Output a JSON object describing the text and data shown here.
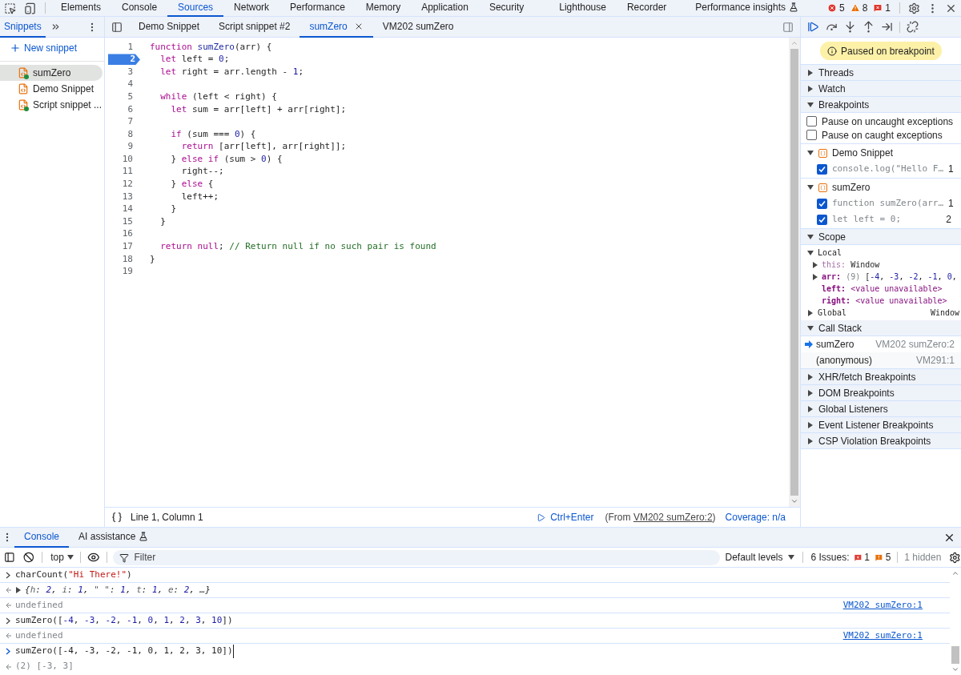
{
  "top_tabs": [
    {
      "label": "Elements",
      "selected": false
    },
    {
      "label": "Console",
      "selected": false
    },
    {
      "label": "Sources",
      "selected": true
    },
    {
      "label": "Network",
      "selected": false
    },
    {
      "label": "Performance",
      "selected": false
    },
    {
      "label": "Memory",
      "selected": false
    },
    {
      "label": "Application",
      "selected": false
    },
    {
      "label": "Security",
      "selected": false
    },
    {
      "label": "Lighthouse",
      "selected": false
    },
    {
      "label": "Recorder",
      "selected": false
    },
    {
      "label": "Performance insights",
      "selected": false,
      "experimental": true
    }
  ],
  "counters": {
    "errors": "5",
    "warnings": "8",
    "issues": "1"
  },
  "navigator": {
    "tab": {
      "label": "Snippets",
      "selected": true
    },
    "new_snippet": "New snippet",
    "files": [
      {
        "name": "sumZero",
        "selected": true,
        "running": true
      },
      {
        "name": "Demo Snippet",
        "selected": false,
        "running": false
      },
      {
        "name": "Script snippet ...",
        "selected": false,
        "running": true
      }
    ]
  },
  "editor_tabs": [
    {
      "label": "Demo Snippet",
      "selected": false
    },
    {
      "label": "Script snippet #2",
      "selected": false
    },
    {
      "label": "sumZero",
      "selected": true
    },
    {
      "label": "VM202 sumZero",
      "selected": false
    }
  ],
  "code_lines": [
    {
      "number": "1",
      "paused": false,
      "tokens": [
        {
          "text": "function ",
          "kind": "keyword"
        },
        {
          "text": "sumZero",
          "kind": "name"
        },
        {
          "text": "(arr) {",
          "kind": "plain"
        }
      ]
    },
    {
      "number": "2",
      "paused": true,
      "tokens": [
        {
          "text": "  let",
          "kind": "keyword"
        },
        {
          "text": " left = ",
          "kind": "plain"
        },
        {
          "text": "0",
          "kind": "number"
        },
        {
          "text": ";",
          "kind": "plain"
        }
      ]
    },
    {
      "number": "3",
      "paused": false,
      "tokens": [
        {
          "text": "  let",
          "kind": "keyword"
        },
        {
          "text": " right = arr.length - ",
          "kind": "plain"
        },
        {
          "text": "1",
          "kind": "number"
        },
        {
          "text": ";",
          "kind": "plain"
        }
      ]
    },
    {
      "number": "4",
      "paused": false
    },
    {
      "number": "5",
      "paused": false,
      "tokens": [
        {
          "text": "  while",
          "kind": "keyword"
        },
        {
          "text": " (left < right) {",
          "kind": "plain"
        }
      ]
    },
    {
      "number": "6",
      "paused": false,
      "tokens": [
        {
          "text": "    let",
          "kind": "keyword"
        },
        {
          "text": " sum = arr[left] + arr[right];",
          "kind": "plain"
        }
      ]
    },
    {
      "number": "7",
      "paused": false
    },
    {
      "number": "8",
      "paused": false,
      "tokens": [
        {
          "text": "    if",
          "kind": "keyword"
        },
        {
          "text": " (sum === ",
          "kind": "plain"
        },
        {
          "text": "0",
          "kind": "number"
        },
        {
          "text": ") {",
          "kind": "plain"
        }
      ]
    },
    {
      "number": "9",
      "paused": false,
      "tokens": [
        {
          "text": "      return",
          "kind": "keyword"
        },
        {
          "text": " [arr[left], arr[right]];",
          "kind": "plain"
        }
      ]
    },
    {
      "number": "10",
      "paused": false,
      "tokens": [
        {
          "text": "    } ",
          "kind": "plain"
        },
        {
          "text": "else if",
          "kind": "keyword"
        },
        {
          "text": " (sum > ",
          "kind": "plain"
        },
        {
          "text": "0",
          "kind": "number"
        },
        {
          "text": ") {",
          "kind": "plain"
        }
      ]
    },
    {
      "number": "11",
      "paused": false,
      "tokens": [
        {
          "text": "      right--;",
          "kind": "plain"
        }
      ]
    },
    {
      "number": "12",
      "paused": false,
      "tokens": [
        {
          "text": "    } ",
          "kind": "plain"
        },
        {
          "text": "else",
          "kind": "keyword"
        },
        {
          "text": " {",
          "kind": "plain"
        }
      ]
    },
    {
      "number": "13",
      "paused": false,
      "tokens": [
        {
          "text": "      left++;",
          "kind": "plain"
        }
      ]
    },
    {
      "number": "14",
      "paused": false,
      "tokens": [
        {
          "text": "    }",
          "kind": "plain"
        }
      ]
    },
    {
      "number": "15",
      "paused": false,
      "tokens": [
        {
          "text": "  }",
          "kind": "plain"
        }
      ]
    },
    {
      "number": "16",
      "paused": false
    },
    {
      "number": "17",
      "paused": false,
      "tokens": [
        {
          "text": "  return null",
          "kind": "keyword"
        },
        {
          "text": "; ",
          "kind": "plain"
        },
        {
          "text": "// Return null if no such pair is found",
          "kind": "comment"
        }
      ]
    },
    {
      "number": "18",
      "paused": false,
      "tokens": [
        {
          "text": "}",
          "kind": "plain"
        }
      ]
    },
    {
      "number": "19",
      "paused": false
    }
  ],
  "status_bar": {
    "position": "Line 1, Column 1",
    "run": "Ctrl+Enter",
    "from_prefix": "(From",
    "from_link": "VM202 sumZero:2",
    "from_suffix": ")",
    "coverage": "Coverage: n/a"
  },
  "debugger": {
    "paused_message": "Paused on breakpoint",
    "sections": [
      {
        "kind": "plain",
        "title": "Threads",
        "expanded": false
      },
      {
        "kind": "plain",
        "title": "Watch",
        "expanded": false
      },
      {
        "kind": "breakpoints",
        "title": "Breakpoints",
        "expanded": true,
        "options": [
          {
            "label": "Pause on uncaught exceptions",
            "checked": false
          },
          {
            "label": "Pause on caught exceptions",
            "checked": false
          }
        ],
        "groups": [
          {
            "file": "Demo Snippet",
            "expanded": true,
            "items": [
              {
                "code": "console.log(\"Hello F…",
                "line": "1",
                "checked": true
              }
            ]
          },
          {
            "file": "sumZero",
            "expanded": true,
            "items": [
              {
                "code": "function sumZero(arr…",
                "line": "1",
                "checked": true
              },
              {
                "code": "let left = 0;",
                "line": "2",
                "checked": true
              }
            ]
          }
        ]
      },
      {
        "kind": "scope",
        "title": "Scope",
        "expanded": true,
        "scopes": [
          {
            "name": "Local",
            "expanded": true,
            "vars": [
              {
                "name": "this:",
                "dim": true,
                "expandable": true,
                "value": [
                  {
                    "text": "Window",
                    "kind": "plain"
                  }
                ]
              },
              {
                "name": "arr:",
                "dim": false,
                "expandable": true,
                "value": [
                  {
                    "text": "(9) ",
                    "kind": "dim"
                  },
                  {
                    "text": "[",
                    "kind": "plain"
                  },
                  {
                    "text": "-4",
                    "kind": "number"
                  },
                  {
                    "text": ", ",
                    "kind": "plain"
                  },
                  {
                    "text": "-3",
                    "kind": "number"
                  },
                  {
                    "text": ", ",
                    "kind": "plain"
                  },
                  {
                    "text": "-2",
                    "kind": "number"
                  },
                  {
                    "text": ", ",
                    "kind": "plain"
                  },
                  {
                    "text": "-1",
                    "kind": "number"
                  },
                  {
                    "text": ", ",
                    "kind": "plain"
                  },
                  {
                    "text": "0",
                    "kind": "number"
                  },
                  {
                    "text": ",",
                    "kind": "plain"
                  }
                ]
              },
              {
                "name": "left:",
                "dim": false,
                "expandable": false,
                "value": [
                  {
                    "text": "<value unavailable>",
                    "kind": "unavailable"
                  }
                ]
              },
              {
                "name": "right:",
                "dim": false,
                "expandable": false,
                "value": [
                  {
                    "text": "<value unavailable>",
                    "kind": "unavailable"
                  }
                ]
              }
            ]
          },
          {
            "name": "Global",
            "expanded": false,
            "value": "Window"
          }
        ]
      },
      {
        "kind": "callstack",
        "title": "Call Stack",
        "expanded": true,
        "frames": [
          {
            "name": "sumZero",
            "location": "VM202 sumZero:2",
            "selected": true
          },
          {
            "name": "(anonymous)",
            "location": "VM291:1",
            "selected": false
          }
        ]
      },
      {
        "kind": "plain",
        "title": "XHR/fetch Breakpoints",
        "expanded": false
      },
      {
        "kind": "plain",
        "title": "DOM Breakpoints",
        "expanded": false
      },
      {
        "kind": "plain",
        "title": "Global Listeners",
        "expanded": false
      },
      {
        "kind": "plain",
        "title": "Event Listener Breakpoints",
        "expanded": false
      },
      {
        "kind": "plain",
        "title": "CSP Violation Breakpoints",
        "expanded": false
      }
    ]
  },
  "drawer_tabs": [
    {
      "label": "Console",
      "selected": true,
      "experimental": false
    },
    {
      "label": "AI assistance",
      "selected": false,
      "experimental": true
    }
  ],
  "console_toolbar": {
    "context": "top",
    "filter_placeholder": "Filter",
    "levels": "Default levels",
    "issues_label": "6 Issues:",
    "issue_errors": "1",
    "issue_warnings": "5",
    "hidden": "1 hidden"
  },
  "console": [
    {
      "kind": "input",
      "active": false,
      "tokens": [
        {
          "text": "charCount(",
          "kind": "plain"
        },
        {
          "text": "\"Hi There!\"",
          "kind": "string"
        },
        {
          "text": ")",
          "kind": "plain"
        }
      ]
    },
    {
      "kind": "object",
      "tokens": [
        {
          "text": "{",
          "kind": "plain"
        },
        {
          "text": "h",
          "kind": "key"
        },
        {
          "text": ": ",
          "kind": "plain"
        },
        {
          "text": "2",
          "kind": "number"
        },
        {
          "text": ", ",
          "kind": "plain"
        },
        {
          "text": "i",
          "kind": "key"
        },
        {
          "text": ": ",
          "kind": "plain"
        },
        {
          "text": "1",
          "kind": "number"
        },
        {
          "text": ", ",
          "kind": "plain"
        },
        {
          "text": "\" \"",
          "kind": "key"
        },
        {
          "text": ": ",
          "kind": "plain"
        },
        {
          "text": "1",
          "kind": "number"
        },
        {
          "text": ", ",
          "kind": "plain"
        },
        {
          "text": "t",
          "kind": "key"
        },
        {
          "text": ": ",
          "kind": "plain"
        },
        {
          "text": "1",
          "kind": "number"
        },
        {
          "text": ", ",
          "kind": "plain"
        },
        {
          "text": "e",
          "kind": "key"
        },
        {
          "text": ": ",
          "kind": "plain"
        },
        {
          "text": "2",
          "kind": "number"
        },
        {
          "text": ", …}",
          "kind": "plain"
        }
      ]
    },
    {
      "kind": "result",
      "tokens": [
        {
          "text": "undefined",
          "kind": "dim"
        }
      ],
      "link": "VM202 sumZero:1"
    },
    {
      "kind": "input",
      "active": false,
      "tokens": [
        {
          "text": "sumZero([",
          "kind": "plain"
        },
        {
          "text": "-4",
          "kind": "number"
        },
        {
          "text": ", ",
          "kind": "plain"
        },
        {
          "text": "-3",
          "kind": "number"
        },
        {
          "text": ", ",
          "kind": "plain"
        },
        {
          "text": "-2",
          "kind": "number"
        },
        {
          "text": ", ",
          "kind": "plain"
        },
        {
          "text": "-1",
          "kind": "number"
        },
        {
          "text": ", ",
          "kind": "plain"
        },
        {
          "text": "0",
          "kind": "number"
        },
        {
          "text": ", ",
          "kind": "plain"
        },
        {
          "text": "1",
          "kind": "number"
        },
        {
          "text": ", ",
          "kind": "plain"
        },
        {
          "text": "2",
          "kind": "number"
        },
        {
          "text": ", ",
          "kind": "plain"
        },
        {
          "text": "3",
          "kind": "number"
        },
        {
          "text": ", ",
          "kind": "plain"
        },
        {
          "text": "10",
          "kind": "number"
        },
        {
          "text": "])",
          "kind": "plain"
        }
      ]
    },
    {
      "kind": "result",
      "tokens": [
        {
          "text": "undefined",
          "kind": "dim"
        }
      ],
      "link": "VM202 sumZero:1"
    },
    {
      "kind": "input",
      "active": true,
      "tokens": [
        {
          "text": "sumZero([-4, -3, -2, -1, 0, 1, 2, 3, 10])",
          "kind": "plain"
        }
      ]
    },
    {
      "kind": "result",
      "tokens": [
        {
          "text": "(2) [-3, 3]",
          "kind": "dim"
        }
      ]
    }
  ]
}
